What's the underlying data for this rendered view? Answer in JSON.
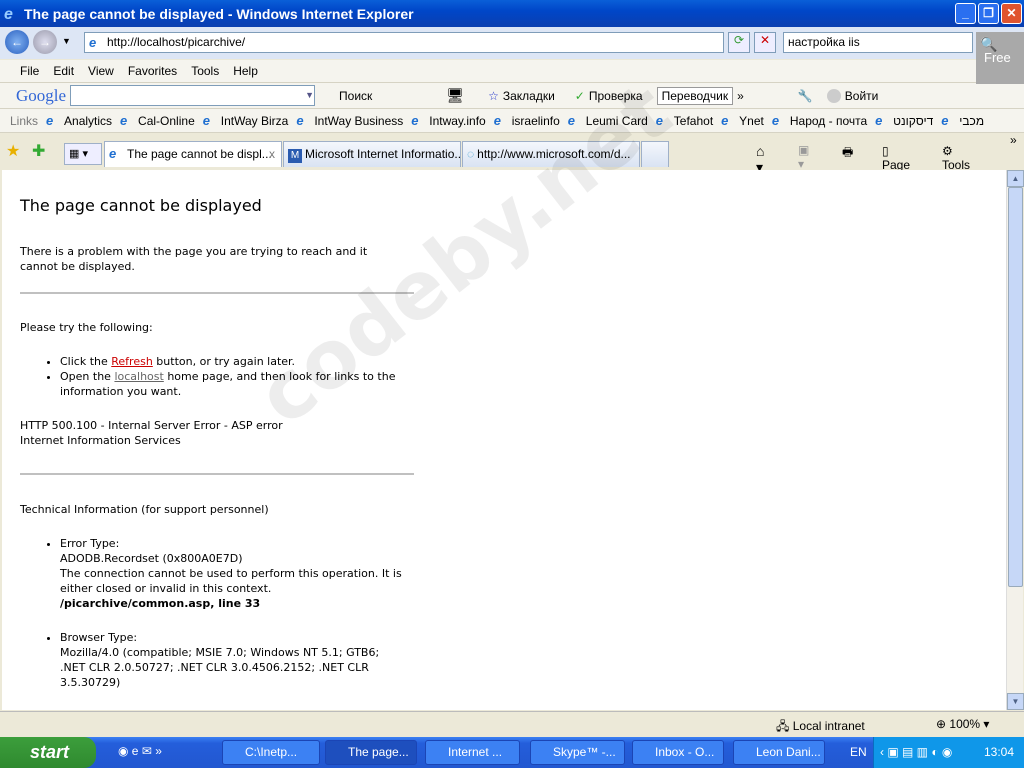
{
  "window": {
    "title": "The page cannot be displayed - Windows Internet Explorer"
  },
  "address": {
    "url": "http://localhost/picarchive/",
    "search_value": "настройка iis",
    "badge": "Free"
  },
  "menu": [
    "File",
    "Edit",
    "View",
    "Favorites",
    "Tools",
    "Help"
  ],
  "google_bar": {
    "logo": "Google",
    "search": "Поиск",
    "bookmarks": "Закладки",
    "spellcheck": "Проверка",
    "translate": "Переводчик",
    "signin": "Войти"
  },
  "links": {
    "label": "Links",
    "items": [
      "Analytics",
      "Cal-Online",
      "IntWay Birza",
      "IntWay Business",
      "Intway.info",
      "israelinfo",
      "Leumi Card",
      "Tefahot",
      "Ynet",
      "Народ - почта",
      "דיסקונט",
      "מכבי"
    ]
  },
  "tabs": [
    {
      "label": "The page cannot be displ...",
      "active": true
    },
    {
      "label": "Microsoft Internet Informatio..."
    },
    {
      "label": "http://www.microsoft.com/d..."
    }
  ],
  "command_bar": {
    "page": "Page",
    "tools": "Tools"
  },
  "page": {
    "heading": "The page cannot be displayed",
    "intro": "There is a problem with the page you are trying to reach and it cannot be displayed.",
    "try_heading": "Please try the following:",
    "bullet1_pre": "Click the ",
    "bullet1_link": "Refresh",
    "bullet1_post": " button, or try again later.",
    "bullet2_pre": "Open the ",
    "bullet2_link": "localhost",
    "bullet2_post": " home page, and then look for links to the information you want.",
    "error_line1": "HTTP 500.100 - Internal Server Error - ASP error",
    "error_line2": "Internet Information Services",
    "tech_heading": "Technical Information (for support personnel)",
    "error_type_label": "Error Type:",
    "error_type": "ADODB.Recordset (0x800A0E7D)",
    "error_message": "The connection cannot be used to perform this operation. It is either closed or invalid in this context.",
    "error_location": "/picarchive/common.asp, line 33",
    "browser_type_label": "Browser Type:",
    "browser_type": "Mozilla/4.0 (compatible; MSIE 7.0; Windows NT 5.1; GTB6; .NET CLR 2.0.50727; .NET CLR 3.0.4506.2152; .NET CLR 3.5.30729)"
  },
  "watermark": "codeby.net",
  "status": {
    "zone": "Local intranet",
    "zoom": "100%"
  },
  "taskbar": {
    "start": "start",
    "tasks": [
      "C:\\Inetp...",
      "The page...",
      "Internet ...",
      "Skype™ -...",
      "Inbox - O...",
      "Leon Dani..."
    ],
    "lang": "EN",
    "clock": "13:04"
  }
}
